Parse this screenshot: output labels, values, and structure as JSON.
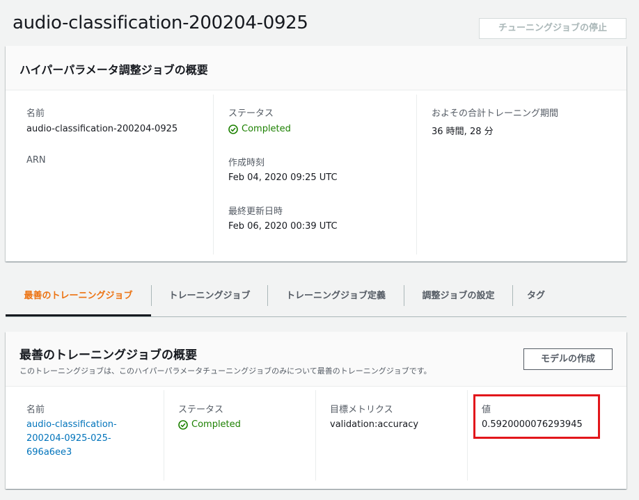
{
  "page": {
    "title": "audio-classification-200204-0925",
    "stop_button_label": "チューニングジョブの停止"
  },
  "summary": {
    "heading": "ハイパーパラメータ調整ジョブの概要",
    "name_label": "名前",
    "name_value": "audio-classification-200204-0925",
    "arn_label": "ARN",
    "status_label": "ステータス",
    "status_value": "Completed",
    "created_label": "作成時刻",
    "created_value": "Feb 04, 2020 09:25 UTC",
    "updated_label": "最終更新日時",
    "updated_value": "Feb 06, 2020 00:39 UTC",
    "duration_label": "およその合計トレーニング期間",
    "duration_value": "36 時間, 28 分"
  },
  "tabs": [
    {
      "label": "最善のトレーニングジョブ",
      "active": true
    },
    {
      "label": "トレーニングジョブ",
      "active": false
    },
    {
      "label": "トレーニングジョブ定義",
      "active": false
    },
    {
      "label": "調整ジョブの設定",
      "active": false
    },
    {
      "label": "タグ",
      "active": false
    }
  ],
  "best": {
    "heading": "最善のトレーニングジョブの概要",
    "description": "このトレーニングジョブは、このハイパーパラメータチューニングジョブのみについて最善のトレーニングジョブです。",
    "create_model_label": "モデルの作成",
    "name_label": "名前",
    "name_line1": "audio-classification-",
    "name_line2": "200204-0925-025-",
    "name_line3": "696a6ee3",
    "status_label": "ステータス",
    "status_value": "Completed",
    "metric_label": "目標メトリクス",
    "metric_value": "validation:accuracy",
    "value_label": "値",
    "value_value": "0.5920000076293945"
  },
  "colors": {
    "accent": "#ec7211",
    "success": "#1d8102",
    "link": "#0073bb",
    "highlight": "#e2161b"
  }
}
